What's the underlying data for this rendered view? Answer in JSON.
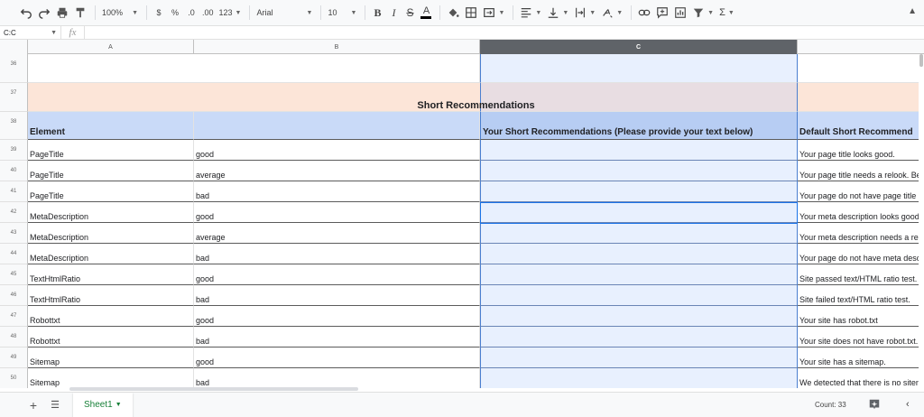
{
  "toolbar": {
    "zoom": "100%",
    "currency": "$",
    "percent": "%",
    "decrease_decimals": ".0",
    "increase_decimals": ".00",
    "more_formats": "123",
    "font": "Arial",
    "font_size": "10",
    "bold": "B",
    "italic": "I",
    "strikethrough": "S",
    "text_color": "A",
    "sigma": "Σ"
  },
  "formula_bar": {
    "name_box": "C:C",
    "fx": "fx",
    "value": ""
  },
  "columns": [
    "A",
    "B",
    "C"
  ],
  "title_row": {
    "number": "37",
    "text": "Short Recommendations"
  },
  "empty_row": {
    "number": "36"
  },
  "header_row": {
    "number": "38",
    "a": "Element",
    "b": "",
    "c": "Your Short Recommendations (Please provide your text below)",
    "d": "Default Short Recommend"
  },
  "rows": [
    {
      "number": "39",
      "a": "PageTitle",
      "b": "good",
      "c": "",
      "d": "Your page title looks good."
    },
    {
      "number": "40",
      "a": "PageTitle",
      "b": "average",
      "c": "",
      "d": "Your page title needs a relook. Be"
    },
    {
      "number": "41",
      "a": "PageTitle",
      "b": "bad",
      "c": "",
      "d": "Your page do not have page title a"
    },
    {
      "number": "42",
      "a": "MetaDescription",
      "b": "good",
      "c": "",
      "d": "Your meta description looks good."
    },
    {
      "number": "43",
      "a": "MetaDescription",
      "b": "average",
      "c": "",
      "d": "Your meta description needs a reli"
    },
    {
      "number": "44",
      "a": "MetaDescription",
      "b": "bad",
      "c": "",
      "d": "Your page do not have meta desc"
    },
    {
      "number": "45",
      "a": "TextHtmlRatio",
      "b": "good",
      "c": "",
      "d": "Site passed text/HTML ratio test."
    },
    {
      "number": "46",
      "a": "TextHtmlRatio",
      "b": "bad",
      "c": "",
      "d": "Site failed text/HTML ratio test."
    },
    {
      "number": "47",
      "a": "Robottxt",
      "b": "good",
      "c": "",
      "d": "Your site has robot.txt"
    },
    {
      "number": "48",
      "a": "Robottxt",
      "b": "bad",
      "c": "",
      "d": "Your site does not have robot.txt."
    },
    {
      "number": "49",
      "a": "Sitemap",
      "b": "good",
      "c": "",
      "d": "Your site has a sitemap."
    },
    {
      "number": "50",
      "a": "Sitemap",
      "b": "bad",
      "c": "",
      "d": "We detected that there is no siten"
    }
  ],
  "bottom": {
    "sheet_name": "Sheet1",
    "count": "Count: 33"
  },
  "colors": {
    "title_fill": "#fce5d8",
    "header_fill": "#c9daf8",
    "selected_column_fill": "#e8f0fe",
    "sheet_tab_text": "#188038"
  }
}
